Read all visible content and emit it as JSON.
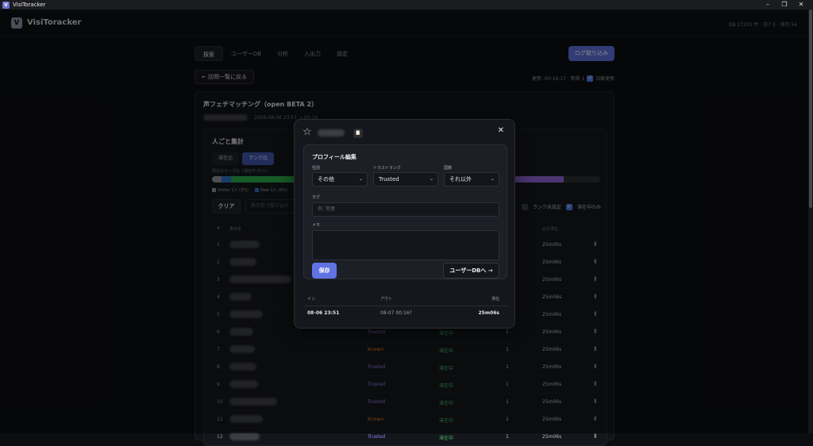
{
  "window": {
    "title": "VisiToracker",
    "controls": [
      "–",
      "❐",
      "✕"
    ]
  },
  "header": {
    "brand": "VisiToracker",
    "logo_letter": "V",
    "stats": "DB 17335 件 · 日7 3 · 保存 54"
  },
  "tabs": [
    "探索",
    "ユーザーDB",
    "分析",
    "入出力",
    "設定"
  ],
  "login_button": "ログ取り込み",
  "back_button": "← 訪問一覧に戻る",
  "update": {
    "text": "更新: 00:16:17 · 新規 1",
    "auto_label": "自動更新",
    "auto_checked": true
  },
  "session": {
    "title": "声フェチマッチング（open BETA 2）",
    "date": "2026-08-06 23:51 → 00:16"
  },
  "summary": {
    "title": "人ごと集計",
    "seg_buttons": [
      "滞在比",
      "ランク比"
    ],
    "active_seg": 1,
    "bar_label": "現在のランク比（滞在中 37人）",
    "bar_colors": [
      "#8a8e97",
      "#2f6dc4",
      "#2aa84a",
      "#3d8f9a",
      "#8a62cc",
      "#2a2c31"
    ],
    "bar_shares": [
      2.5,
      2.5,
      31,
      10,
      44.5,
      9.5
    ],
    "legend": [
      {
        "color": "#8a8e97",
        "label": "Visitor 1人 (3%)"
      },
      {
        "color": "#2f6dc4",
        "label": "New 1人 (3%)"
      }
    ],
    "clear_button": "クリア",
    "filter_placeholder": "表示名で絞り込み",
    "toggle_unset": "ランク未設定",
    "toggle_staying": "滞在中のみ",
    "columns": {
      "num": "#",
      "name": "表示名",
      "total": "合計滞在"
    }
  },
  "rows": [
    {
      "num": "1",
      "rank": "",
      "rank_class": "",
      "status": "",
      "count": "",
      "time": "25m06s"
    },
    {
      "num": "2",
      "rank": "",
      "rank_class": "",
      "status": "",
      "count": "",
      "time": "25m06s"
    },
    {
      "num": "3",
      "rank": "",
      "rank_class": "",
      "status": "",
      "count": "",
      "time": "25m06s"
    },
    {
      "num": "4",
      "rank": "",
      "rank_class": "",
      "status": "",
      "count": "",
      "time": "25m06s"
    },
    {
      "num": "5",
      "rank": "",
      "rank_class": "",
      "status": "",
      "count": "",
      "time": "25m06s"
    },
    {
      "num": "6",
      "rank": "Trusted",
      "rank_class": "trusted",
      "status": "滞在中",
      "count": "1",
      "time": "25m06s"
    },
    {
      "num": "7",
      "rank": "Known",
      "rank_class": "known",
      "status": "滞在中",
      "count": "1",
      "time": "25m06s"
    },
    {
      "num": "8",
      "rank": "Trusted",
      "rank_class": "trusted",
      "status": "滞在中",
      "count": "1",
      "time": "25m06s"
    },
    {
      "num": "9",
      "rank": "Trusted",
      "rank_class": "trusted",
      "status": "滞在中",
      "count": "1",
      "time": "25m06s"
    },
    {
      "num": "10",
      "rank": "Trusted",
      "rank_class": "trusted",
      "status": "滞在中",
      "count": "1",
      "time": "25m06s"
    },
    {
      "num": "11",
      "rank": "Known",
      "rank_class": "known",
      "status": "滞在中",
      "count": "1",
      "time": "25m06s"
    },
    {
      "num": "12",
      "rank": "Trusted",
      "rank_class": "trusted",
      "status": "滞在中",
      "count": "1",
      "time": "25m06s"
    }
  ],
  "modal": {
    "clip_icon": "clipboard-icon",
    "edit_title": "プロフィール編集",
    "gender_label": "性別",
    "gender_value": "その他",
    "trust_label": "トラストランク",
    "trust_value": "Trusted",
    "origin_label": "国籍",
    "origin_value": "それ以外",
    "tag_label": "タグ",
    "tag_placeholder": "例: 常連",
    "memo_label": "メモ",
    "save_button": "保存",
    "userdb_button": "ユーザーDBへ →",
    "visit_headers": {
      "in": "イン",
      "out": "アウト",
      "stay": "滞在"
    },
    "visit": {
      "in": "08-06 23:51",
      "out": "08-07 00:16?",
      "stay": "25m06s"
    }
  }
}
